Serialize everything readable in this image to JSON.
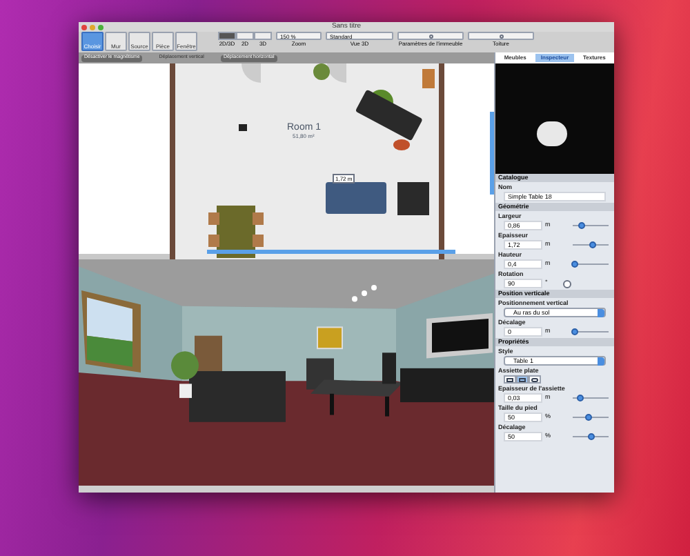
{
  "window": {
    "title": "Sans titre"
  },
  "tools": [
    {
      "label": "Choisir",
      "selected": true
    },
    {
      "label": "Mur",
      "selected": false
    },
    {
      "label": "Source",
      "selected": false
    },
    {
      "label": "Pièce",
      "selected": false
    },
    {
      "label": "Fenêtre",
      "selected": false
    }
  ],
  "view_modes": [
    {
      "label": "2D/3D",
      "selected": true
    },
    {
      "label": "2D",
      "selected": false
    },
    {
      "label": "3D",
      "selected": false
    }
  ],
  "zoom": {
    "value": "150 %",
    "label": "Zoom"
  },
  "view_3d": {
    "value": "Standard",
    "label": "Vue 3D"
  },
  "buttons": [
    {
      "label": "Paramètres de l'immeuble"
    },
    {
      "label": "Toiture"
    }
  ],
  "plan_toolbar": [
    {
      "label": "Désactiver le magnétisme",
      "selected": true
    },
    {
      "label": "Déplacement vertical",
      "selected": false
    },
    {
      "label": "Déplacement horizontal",
      "selected": true
    }
  ],
  "side_tabs": [
    {
      "label": "Meubles",
      "selected": false
    },
    {
      "label": "Inspecteur",
      "selected": true
    },
    {
      "label": "Textures",
      "selected": false
    }
  ],
  "plan": {
    "room_name": "Room 1",
    "room_area": "51,80 m²",
    "dimension": "1,72 m"
  },
  "inspector": [
    {
      "title": "Catalogue",
      "fields": [
        {
          "kind": "text",
          "label": "Nom",
          "value": "Simple Table 18"
        }
      ]
    },
    {
      "title": "Géométrie",
      "fields": [
        {
          "kind": "number",
          "label": "Largeur",
          "value": "0,86",
          "unit": "m",
          "level": 0.25
        },
        {
          "kind": "number",
          "label": "Epaisseur",
          "value": "1,72",
          "unit": "m",
          "level": 0.55
        },
        {
          "kind": "number",
          "label": "Hauteur",
          "value": "0,4",
          "unit": "m",
          "level": 0.05
        },
        {
          "kind": "angle",
          "label": "Rotation",
          "value": "90",
          "unit": "°"
        }
      ]
    },
    {
      "title": "Position verticale",
      "fields": [
        {
          "kind": "select",
          "label": "Positionnement vertical",
          "value": "Au ras du sol"
        },
        {
          "kind": "number",
          "label": "Décalage",
          "value": "0",
          "unit": "m",
          "level": 0.05
        }
      ]
    },
    {
      "title": "Propriétés",
      "fields": [
        {
          "kind": "select",
          "label": "Style",
          "value": "Table 1"
        },
        {
          "kind": "segmented",
          "label": "Assiette plate",
          "options": [
            {
              "selected": false
            },
            {
              "selected": true
            },
            {
              "selected": false
            }
          ]
        },
        {
          "kind": "number",
          "label": "Epaisseur de l'assiette",
          "value": "0,03",
          "unit": "m",
          "level": 0.2
        },
        {
          "kind": "number",
          "label": "Taille du pied",
          "value": "50",
          "unit": "%",
          "level": 0.45
        },
        {
          "kind": "number",
          "label": "Décalage",
          "value": "50",
          "unit": "%",
          "level": 0.5
        }
      ]
    }
  ]
}
